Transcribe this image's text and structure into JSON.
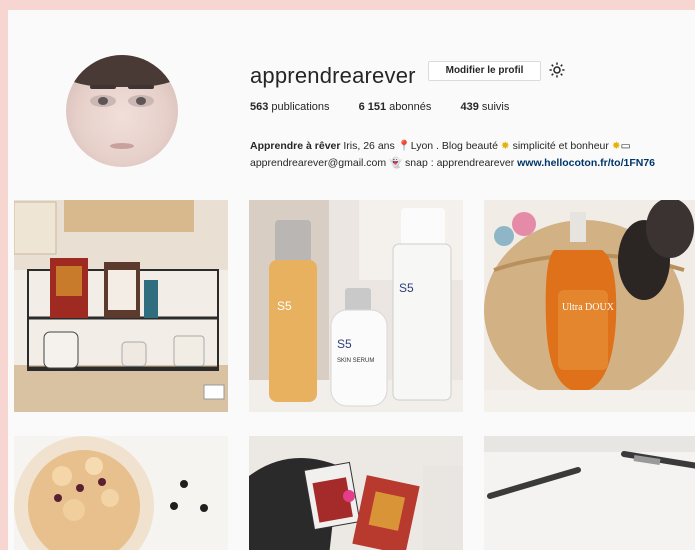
{
  "profile": {
    "username": "apprendrearever",
    "edit_button": "Modifier le profil",
    "stats": [
      {
        "count": "563",
        "label": "publications"
      },
      {
        "count": "6 151",
        "label": "abonnés"
      },
      {
        "count": "439",
        "label": "suivis"
      }
    ],
    "bio": {
      "name": "Apprendre à rêver",
      "line1_a": " Iris, 26 ans ",
      "line1_b": "Lyon . Blog beauté ",
      "line1_c": " simplicité et bonheur ",
      "line2_a": "apprendrearever@gmail.com ",
      "line2_b": " snap : apprendrearever ",
      "link": "www.hellocoton.fr/to/1FN76"
    }
  },
  "icons": {
    "gear": "gear-icon",
    "pin": "pin-icon",
    "sun": "sun-icon",
    "ghost": "ghost-icon"
  },
  "grid": {
    "row1": [
      {
        "name": "photo-shelf",
        "alt_text": "S5",
        "bottle_text": "Ultra DOUX"
      },
      {
        "name": "photo-skincare-bottles"
      },
      {
        "name": "photo-oil-bag"
      }
    ],
    "product_texts": {
      "brand": "S5",
      "serum": "SKIN SERUM",
      "oil_brand": "Ultra DOUX"
    }
  }
}
